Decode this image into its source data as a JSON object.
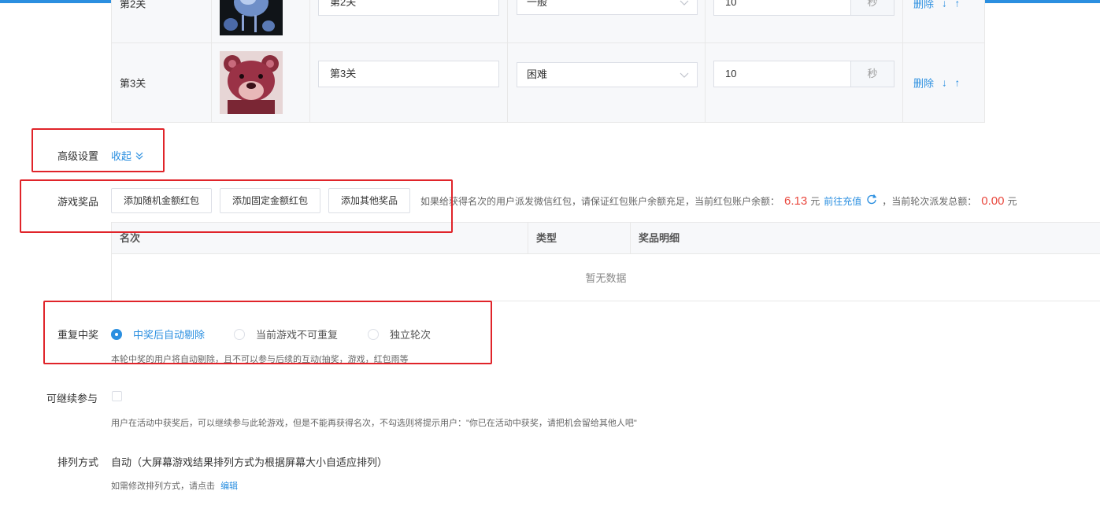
{
  "levels": [
    {
      "label": "第2关",
      "title_value": "第2关",
      "difficulty": "一般",
      "time_value": "10",
      "time_unit": "秒",
      "delete_label": "删除",
      "down_arrow": "↓",
      "up_arrow": "↑"
    },
    {
      "label": "第3关",
      "title_value": "第3关",
      "difficulty": "困难",
      "time_value": "10",
      "time_unit": "秒",
      "delete_label": "删除",
      "down_arrow": "↓",
      "up_arrow": "↑"
    }
  ],
  "advanced": {
    "label": "高级设置",
    "toggle_label": "收起"
  },
  "prizes": {
    "label": "游戏奖品",
    "buttons": [
      "添加随机金额红包",
      "添加固定金额红包",
      "添加其他奖品"
    ],
    "hint_prefix": "如果给获得名次的用户派发微信红包，请保证红包账户余额充足，当前红包账户余额：",
    "balance": "6.13",
    "currency": "元",
    "recharge_label": "前往充值",
    "total_prefix": "，当前轮次派发总额：",
    "total": "0.00",
    "total_currency": "元",
    "columns": [
      "名次",
      "类型",
      "奖品明细"
    ],
    "empty_text": "暂无数据"
  },
  "repeat": {
    "label": "重复中奖",
    "options": [
      "中奖后自动剔除",
      "当前游戏不可重复",
      "独立轮次"
    ],
    "selected_index": 0,
    "hint": "本轮中奖的用户将自动剔除，且不可以参与后续的互动(抽奖，游戏，红包雨等"
  },
  "continue": {
    "label": "可继续参与",
    "checked": false,
    "hint": "用户在活动中获奖后，可以继续参与此轮游戏，但是不能再获得名次，不勾选则将提示用户：\"你已在活动中获奖，请把机会留给其他人吧\""
  },
  "arrange": {
    "label": "排列方式",
    "value": "自动（大屏幕游戏结果排列方式为根据屏幕大小自适应排列）",
    "hint_prefix": "如需修改排列方式，请点击",
    "edit_label": "编辑"
  },
  "colors": {
    "accent": "#2b8fe0",
    "danger": "#e9473d",
    "annotation": "#e0242a"
  }
}
